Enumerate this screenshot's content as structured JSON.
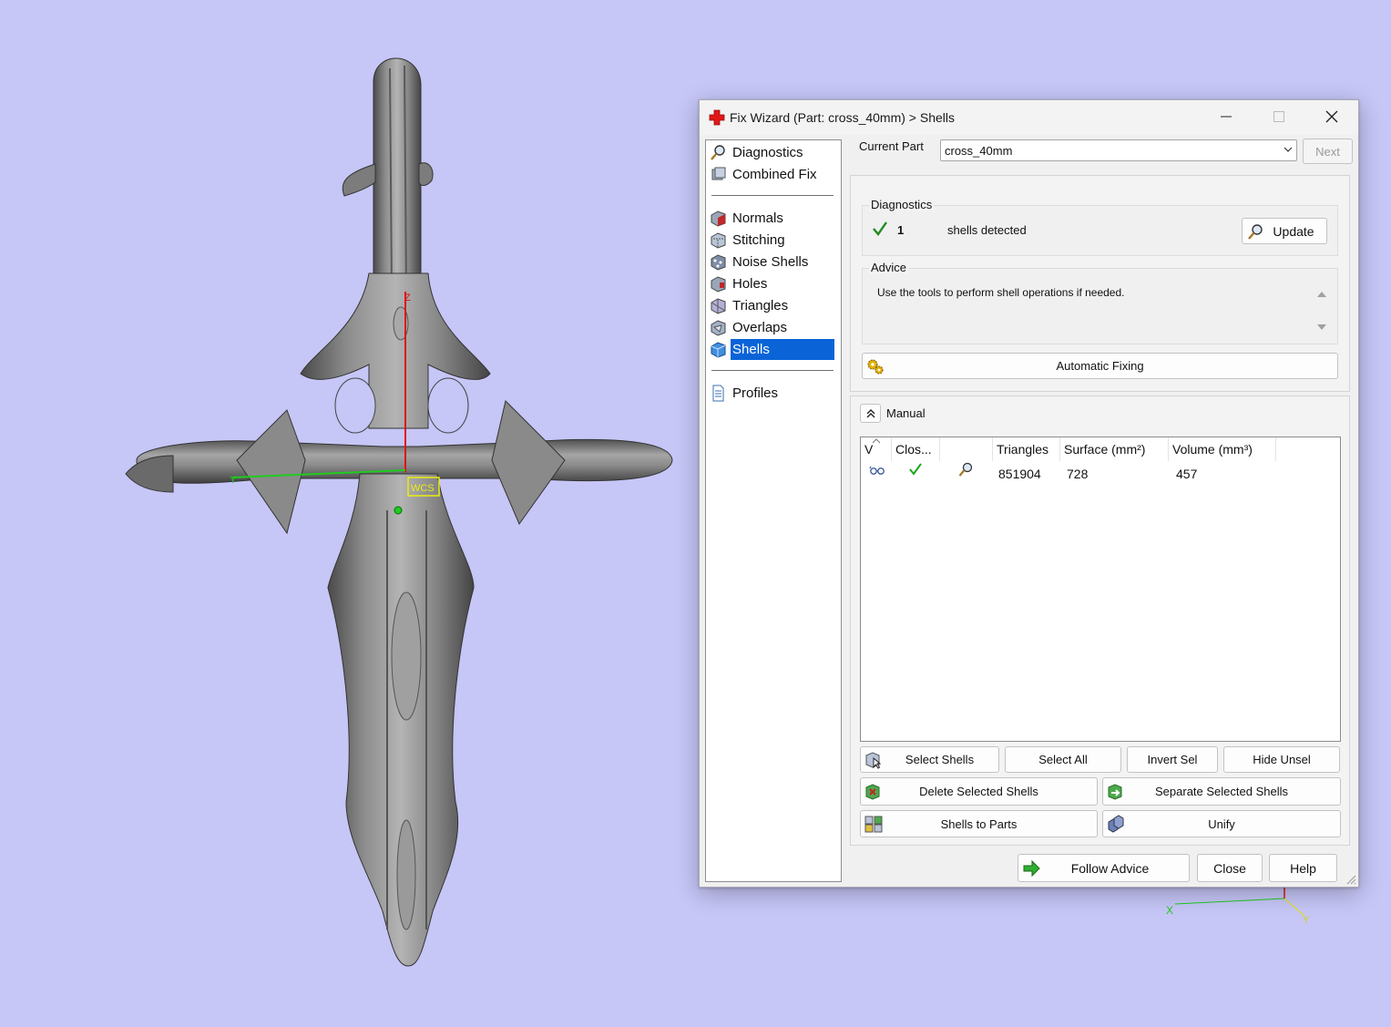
{
  "viewport": {
    "model_name": "cross_40mm",
    "origin_label": "WCS",
    "axis_z_label": "Z",
    "axis_y_label": "Y",
    "mini_axis_x_label": "X",
    "mini_axis_y_label": "Y",
    "background_color": "#c6c6f7"
  },
  "dialog": {
    "title": "Fix Wizard (Part: cross_40mm) > Shells",
    "icons": {
      "app": "red-cross-icon",
      "minimize": "minimize-icon",
      "maximize": "maximize-icon",
      "close": "close-icon"
    }
  },
  "nav": {
    "groups": [
      [
        {
          "label": "Diagnostics",
          "icon": "magnifier-icon"
        },
        {
          "label": "Combined Fix",
          "icon": "cube-stack-icon"
        }
      ],
      [
        {
          "label": "Normals",
          "icon": "normals-cube-icon"
        },
        {
          "label": "Stitching",
          "icon": "stitching-cube-icon"
        },
        {
          "label": "Noise Shells",
          "icon": "noise-shells-icon"
        },
        {
          "label": "Holes",
          "icon": "holes-cube-icon"
        },
        {
          "label": "Triangles",
          "icon": "triangles-cube-icon"
        },
        {
          "label": "Overlaps",
          "icon": "overlaps-cube-icon"
        },
        {
          "label": "Shells",
          "icon": "shells-cube-icon",
          "selected": true
        }
      ],
      [
        {
          "label": "Profiles",
          "icon": "document-icon"
        }
      ]
    ]
  },
  "current_part": {
    "label": "Current Part",
    "value": "cross_40mm",
    "next_label": "Next"
  },
  "diagnostics": {
    "title": "Diagnostics",
    "count": "1",
    "text": "shells detected",
    "status": "ok",
    "update_label": "Update"
  },
  "advice": {
    "title": "Advice",
    "text": "Use the tools to perform shell operations if needed."
  },
  "automatic_fixing_label": "Automatic Fixing",
  "manual": {
    "label": "Manual",
    "columns": [
      "V",
      "Clos...",
      "",
      "Triangles",
      "Surface (mm²)",
      "Volume (mm³)"
    ],
    "rows": [
      {
        "visible": true,
        "closed": true,
        "triangles": "851904",
        "surface": "728",
        "volume": "457"
      }
    ],
    "buttons": {
      "select_shells": "Select Shells",
      "select_all": "Select All",
      "invert_sel": "Invert Sel",
      "hide_unsel": "Hide Unsel",
      "delete_selected": "Delete Selected Shells",
      "separate_selected": "Separate Selected Shells",
      "shells_to_parts": "Shells to Parts",
      "unify": "Unify"
    }
  },
  "footer": {
    "follow_advice": "Follow Advice",
    "close": "Close",
    "help": "Help"
  },
  "colors": {
    "accent": "#0a64d8",
    "check": "#1aa81a",
    "axis_z": "#e01010",
    "axis_y": "#1fcc1f",
    "wcs": "#ecec10"
  }
}
